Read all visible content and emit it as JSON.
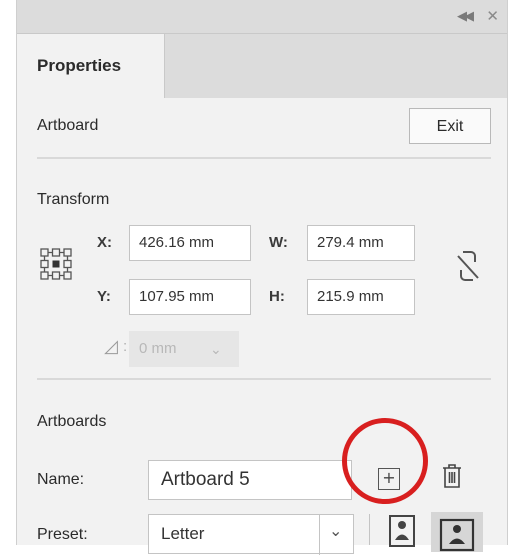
{
  "panel": {
    "tab_label": "Properties",
    "collapse_icon": "double-chevron-left-icon",
    "close_icon": "close-icon"
  },
  "artboard_section": {
    "title": "Artboard",
    "exit_label": "Exit"
  },
  "transform": {
    "title": "Transform",
    "x_label": "X:",
    "x_value": "426.16 mm",
    "y_label": "Y:",
    "y_value": "107.95 mm",
    "w_label": "W:",
    "w_value": "279.4 mm",
    "h_label": "H:",
    "h_value": "215.9 mm",
    "angle_label": ":",
    "angle_value": "0 mm"
  },
  "artboards": {
    "title": "Artboards",
    "name_label": "Name:",
    "name_value": "Artboard 5",
    "preset_label": "Preset:",
    "preset_value": "Letter"
  },
  "colors": {
    "panel_bg": "#f2f2f2",
    "header_bg": "#dcdcdc",
    "highlight_circle": "#d81f1f"
  }
}
